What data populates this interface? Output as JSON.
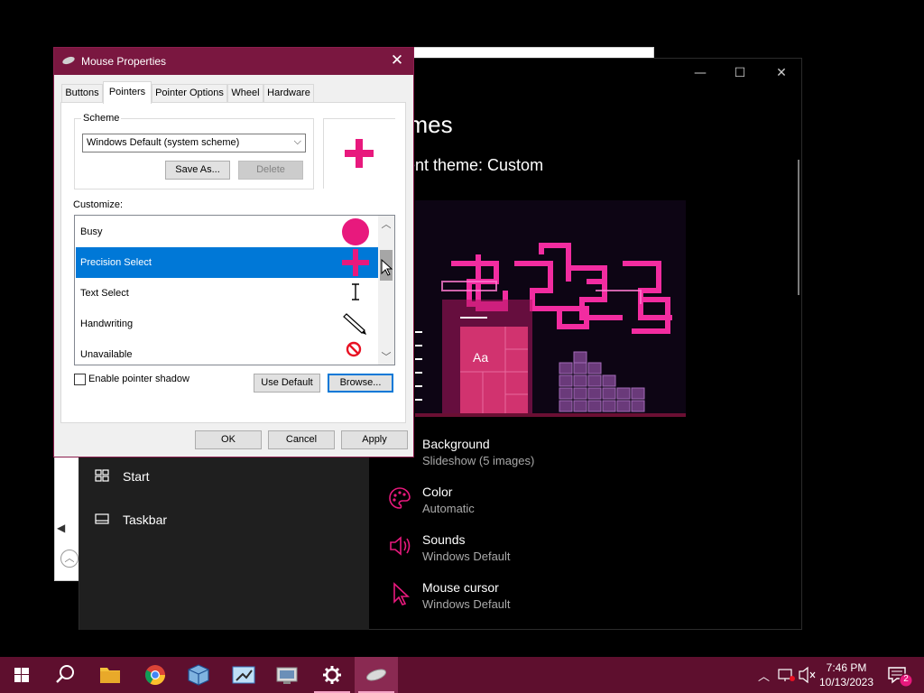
{
  "mouse_dialog": {
    "title": "Mouse Properties",
    "close_glyph": "✕",
    "tabs": [
      "Buttons",
      "Pointers",
      "Pointer Options",
      "Wheel",
      "Hardware"
    ],
    "active_tab": "Pointers",
    "scheme_label": "Scheme",
    "scheme_value": "Windows Default (system scheme)",
    "save_as_label": "Save As...",
    "delete_label": "Delete",
    "customize_label": "Customize:",
    "cursor_list": [
      {
        "label": "Busy",
        "icon": "busy-circle-icon"
      },
      {
        "label": "Precision Select",
        "icon": "crosshair-icon",
        "selected": true
      },
      {
        "label": "Text Select",
        "icon": "ibeam-icon"
      },
      {
        "label": "Handwriting",
        "icon": "pen-icon"
      },
      {
        "label": "Unavailable",
        "icon": "unavailable-icon"
      }
    ],
    "shadow_checkbox_label": "Enable pointer shadow",
    "shadow_checked": false,
    "use_default_label": "Use Default",
    "browse_label": "Browse...",
    "ok_label": "OK",
    "cancel_label": "Cancel",
    "apply_label": "Apply"
  },
  "settings_window": {
    "title_fragment": "emes",
    "current_theme": "rrent theme: Custom",
    "preview_sample": "Aa",
    "sidebar": [
      {
        "label": "Start",
        "icon": "start-layout-icon"
      },
      {
        "label": "Taskbar",
        "icon": "taskbar-icon"
      }
    ],
    "properties": [
      {
        "title": "Background",
        "value": "Slideshow (5 images)",
        "icon": "background-icon"
      },
      {
        "title": "Color",
        "value": "Automatic",
        "icon": "palette-icon"
      },
      {
        "title": "Sounds",
        "value": "Windows Default",
        "icon": "speaker-icon"
      },
      {
        "title": "Mouse cursor",
        "value": "Windows Default",
        "icon": "cursor-icon"
      }
    ]
  },
  "taskbar": {
    "apps": [
      "start-icon",
      "search-icon",
      "file-explorer-icon",
      "chrome-icon",
      "virtualbox-icon",
      "snipping-tool-icon",
      "remote-desktop-icon",
      "settings-icon",
      "mouse-icon"
    ],
    "time": "7:46 PM",
    "date": "10/13/2023",
    "notification_count": "2"
  },
  "colors": {
    "accent": "#e8197d",
    "taskbar": "#5e0f2e",
    "dialog_title": "#7a1740",
    "selection": "#0078d7"
  }
}
